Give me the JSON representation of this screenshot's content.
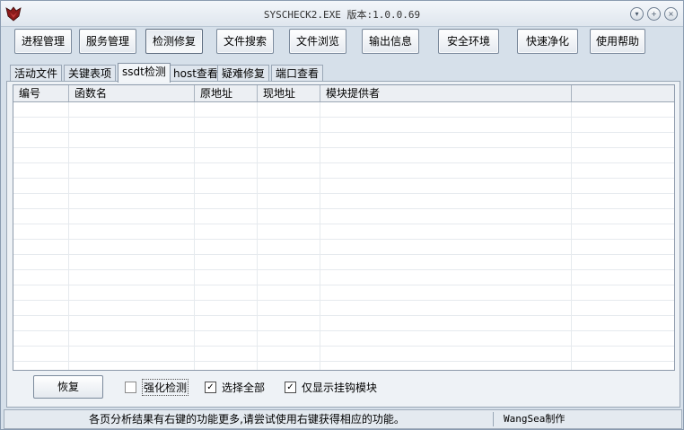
{
  "window": {
    "title": "SYSCHECK2.EXE  版本:1.0.0.69",
    "icon": "app-logo-icon",
    "controls": [
      "minimize-icon",
      "restore-icon",
      "close-icon"
    ]
  },
  "toolbar": {
    "buttons": [
      {
        "label": "进程管理"
      },
      {
        "label": "服务管理"
      },
      {
        "label": "检测修复",
        "active": true
      },
      {
        "label": "文件搜索"
      },
      {
        "label": "文件浏览"
      },
      {
        "label": "输出信息"
      },
      {
        "label": "安全环境"
      },
      {
        "label": "快速净化"
      },
      {
        "label": "使用帮助"
      }
    ]
  },
  "tabs": [
    {
      "label": "活动文件"
    },
    {
      "label": "关键表项"
    },
    {
      "label": "ssdt检测",
      "active": true
    },
    {
      "label": "host查看"
    },
    {
      "label": "疑难修复"
    },
    {
      "label": "端口查看"
    }
  ],
  "table": {
    "columns": [
      "编号",
      "函数名",
      "原地址",
      "现地址",
      "模块提供者",
      ""
    ],
    "rows": []
  },
  "controls": {
    "restore_label": "恢复",
    "checkboxes": [
      {
        "label": "强化检测",
        "checked": false
      },
      {
        "label": "选择全部",
        "checked": true
      },
      {
        "label": "仅显示挂钩模块",
        "checked": true
      }
    ]
  },
  "status": {
    "message": "各页分析结果有右键的功能更多,请尝试使用右键获得相应的功能。",
    "author": "WangSea制作"
  },
  "colors": {
    "background": "#d6e0ea",
    "title_bar": "#e8edf3",
    "logo": "#8b1a1a"
  }
}
